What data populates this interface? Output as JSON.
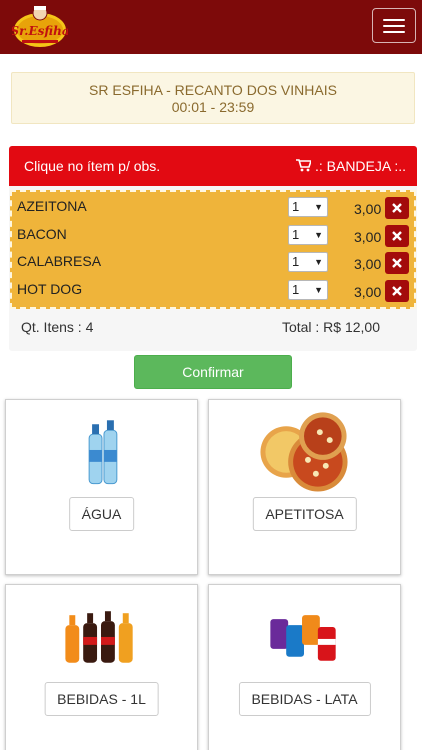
{
  "header": {
    "logo_text": "Sr.Esfiha",
    "menu_icon": "hamburger-icon"
  },
  "store": {
    "name": "SR ESFIHA - RECANTO DOS VINHAIS",
    "hours": "00:01 - 23:59"
  },
  "tray": {
    "hint": "Clique no ítem p/ obs.",
    "label": ".: BANDEJA :..",
    "items": [
      {
        "name": "AZEITONA",
        "qty": "1",
        "price": "3,00"
      },
      {
        "name": "BACON",
        "qty": "1",
        "price": "3,00"
      },
      {
        "name": "CALABRESA",
        "qty": "1",
        "price": "3,00"
      },
      {
        "name": "HOT DOG",
        "qty": "1",
        "price": "3,00"
      }
    ],
    "count_text": "Qt. Itens : 4",
    "total_text": "Total : R$ 12,00"
  },
  "confirm_label": "Confirmar",
  "categories": [
    {
      "label": "ÁGUA",
      "icon": "water-bottles-image"
    },
    {
      "label": "APETITOSA",
      "icon": "pizza-image"
    },
    {
      "label": "BEBIDAS - 1L",
      "icon": "soda-bottles-image"
    },
    {
      "label": "BEBIDAS - LATA",
      "icon": "soda-cans-image"
    }
  ],
  "colors": {
    "topbar": "#7d0a0a",
    "tray_header": "#e20a12",
    "tray_items": "#efb43a",
    "confirm": "#5cb85c",
    "remove": "#a30b0b"
  }
}
